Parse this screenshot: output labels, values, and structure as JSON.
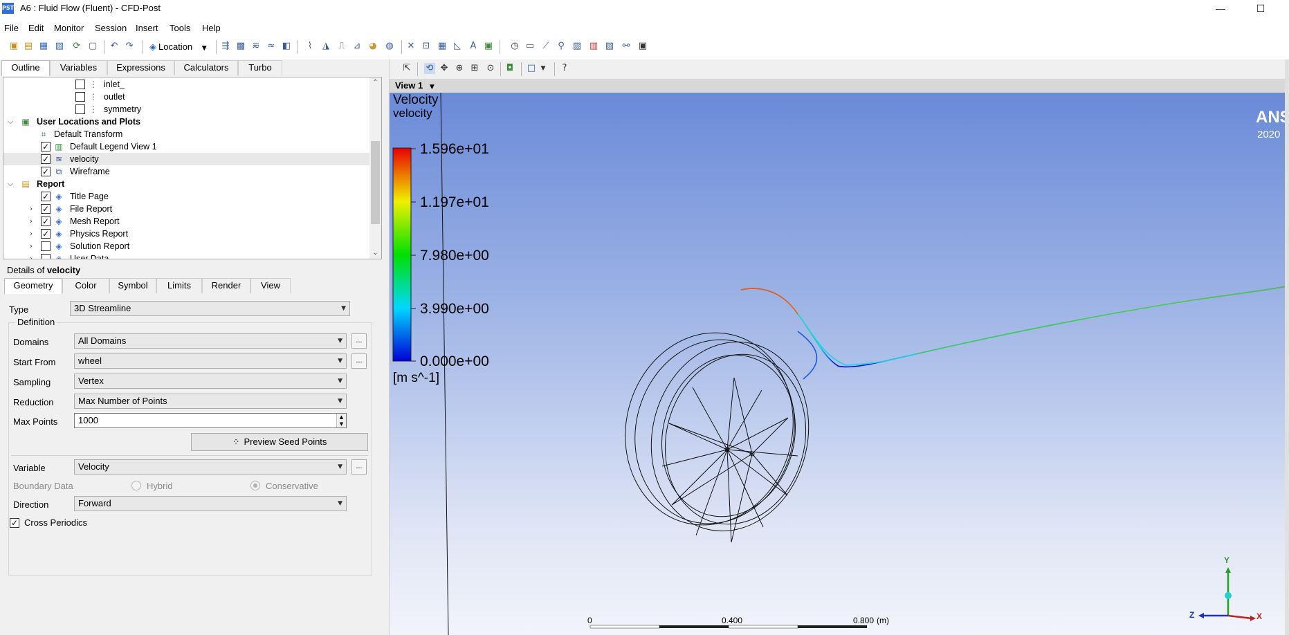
{
  "window": {
    "icon_label": "PST",
    "title": "A6 : Fluid Flow (Fluent) - CFD-Post",
    "minimize": "—",
    "maximize": "☐"
  },
  "menu": [
    "File",
    "Edit",
    "Monitor",
    "Session",
    "Insert",
    "Tools",
    "Help"
  ],
  "toolbar": {
    "location_label": "Location"
  },
  "outline_tabs": [
    "Outline",
    "Variables",
    "Expressions",
    "Calculators",
    "Turbo"
  ],
  "tree": [
    {
      "label": "inlet_",
      "checked": false,
      "bold": false
    },
    {
      "label": "outlet",
      "checked": false,
      "bold": false
    },
    {
      "label": "symmetry",
      "checked": false,
      "bold": false
    },
    {
      "label": "User Locations and Plots",
      "bold": true
    },
    {
      "label": "Default Transform",
      "bold": false
    },
    {
      "label": "Default Legend View 1",
      "checked": true,
      "bold": false
    },
    {
      "label": "velocity",
      "checked": true,
      "bold": false,
      "selected": true
    },
    {
      "label": "Wireframe",
      "checked": true,
      "bold": false
    },
    {
      "label": "Report",
      "bold": true
    },
    {
      "label": "Title Page",
      "checked": true,
      "bold": false
    },
    {
      "label": "File Report",
      "checked": true,
      "bold": false
    },
    {
      "label": "Mesh Report",
      "checked": true,
      "bold": false
    },
    {
      "label": "Physics Report",
      "checked": true,
      "bold": false
    },
    {
      "label": "Solution Report",
      "checked": false,
      "bold": false
    },
    {
      "label": "User Data",
      "checked": false,
      "bold": false
    }
  ],
  "details": {
    "prefix": "Details of",
    "object": "velocity",
    "tabs": [
      "Geometry",
      "Color",
      "Symbol",
      "Limits",
      "Render",
      "View"
    ],
    "type_label": "Type",
    "type_value": "3D Streamline",
    "definition_label": "Definition",
    "domains_label": "Domains",
    "domains_value": "All Domains",
    "start_from_label": "Start From",
    "start_from_value": "wheel",
    "sampling_label": "Sampling",
    "sampling_value": "Vertex",
    "reduction_label": "Reduction",
    "reduction_value": "Max Number of Points",
    "max_points_label": "Max Points",
    "max_points_value": "1000",
    "preview_button": "Preview Seed Points",
    "variable_label": "Variable",
    "variable_value": "Velocity",
    "boundary_data_label": "Boundary Data",
    "hybrid_label": "Hybrid",
    "conservative_label": "Conservative",
    "direction_label": "Direction",
    "direction_value": "Forward",
    "cross_periodics_label": "Cross Periodics",
    "dots": "..."
  },
  "viewer": {
    "view_tab": "View 1",
    "legend_title": "Velocity",
    "legend_variable": "velocity",
    "legend_ticks": [
      "1.596e+01",
      "1.197e+01",
      "7.980e+00",
      "3.990e+00",
      "0.000e+00"
    ],
    "legend_unit": "[m s^-1]",
    "logo_text": "ANSYS",
    "logo_year": "2020",
    "scale_labels": [
      "0",
      "0.400",
      "0.800"
    ],
    "scale_unit": "(m)",
    "axis_labels": [
      "Y",
      "Z",
      "X"
    ]
  }
}
